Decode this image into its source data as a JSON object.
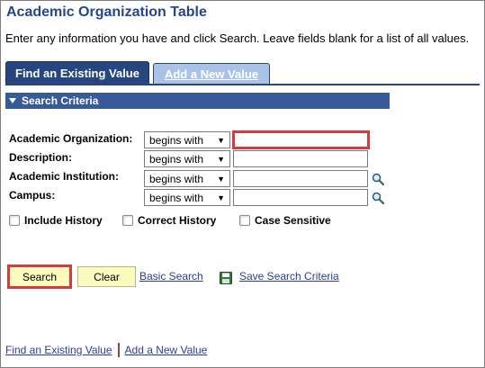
{
  "page": {
    "title": "Academic Organization Table",
    "instructions": "Enter any information you have and click Search. Leave fields blank for a list of all values."
  },
  "tabs": [
    {
      "label": "Find an Existing Value",
      "active": true
    },
    {
      "label": "Add a New Value",
      "active": false
    }
  ],
  "search_criteria": {
    "header": "Search Criteria",
    "fields": [
      {
        "label": "Academic Organization:",
        "operator": "begins with",
        "value": "",
        "lookup": false
      },
      {
        "label": "Description:",
        "operator": "begins with",
        "value": "",
        "lookup": false
      },
      {
        "label": "Academic Institution:",
        "operator": "begins with",
        "value": "",
        "lookup": true
      },
      {
        "label": "Campus:",
        "operator": "begins with",
        "value": "",
        "lookup": true
      }
    ],
    "checkboxes": [
      {
        "label": "Include History",
        "checked": false
      },
      {
        "label": "Correct History",
        "checked": false
      },
      {
        "label": "Case Sensitive",
        "checked": false
      }
    ]
  },
  "actions": {
    "search_label": "Search",
    "clear_label": "Clear",
    "basic_search_label": "Basic Search",
    "save_criteria_label": "Save Search Criteria"
  },
  "footer": {
    "find_label": "Find an Existing Value",
    "add_label": "Add a New Value"
  },
  "colors": {
    "title": "#26468a",
    "tab_active": "#27457f",
    "tab_inactive": "#a9c2e6",
    "section_bar": "#375a99",
    "button_bg": "#fbfbbd",
    "highlight": "#d6393e",
    "link": "#2c3c9b"
  },
  "icons": {
    "lookup": "magnifier-icon",
    "save": "floppy-disk-icon",
    "section_toggle": "caret-down-icon"
  }
}
